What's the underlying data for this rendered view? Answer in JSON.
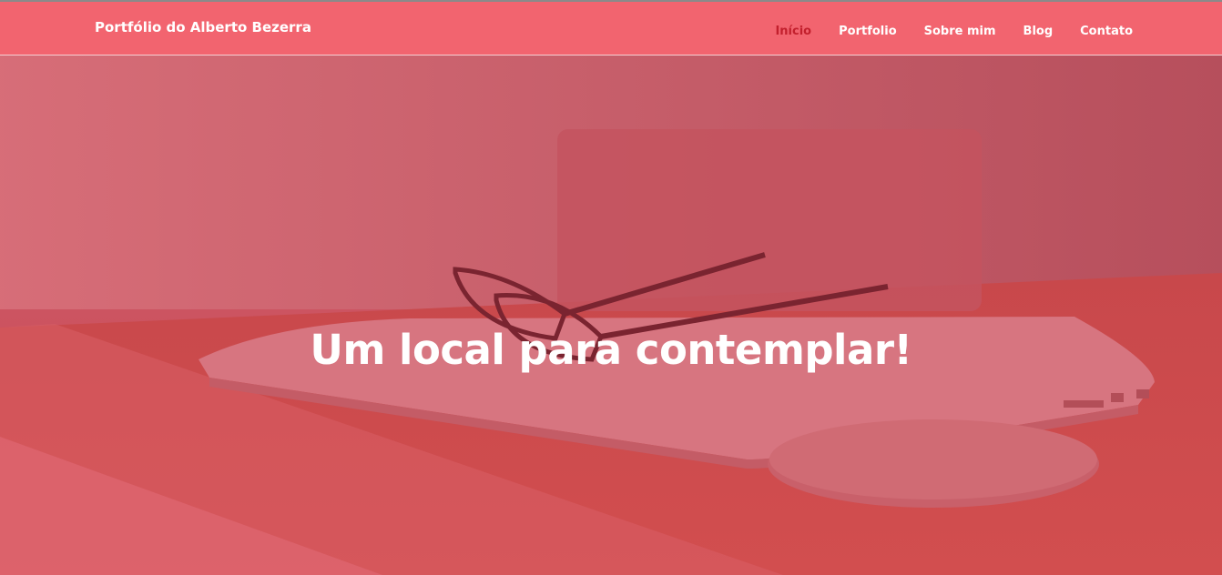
{
  "header": {
    "brand": "Portfólio do Alberto Bezerra",
    "nav": [
      {
        "label": "Início",
        "active": true
      },
      {
        "label": "Portfolio",
        "active": false
      },
      {
        "label": "Sobre mim",
        "active": false
      },
      {
        "label": "Blog",
        "active": false
      },
      {
        "label": "Contato",
        "active": false
      }
    ]
  },
  "hero": {
    "headline": "Um local para contemplar!",
    "background": "desk-laptop-glasses-mouse-image"
  },
  "colors": {
    "navbar": "#f2646f",
    "active_link": "#c2202d",
    "overlay": "#d9525c",
    "text": "#ffffff"
  }
}
